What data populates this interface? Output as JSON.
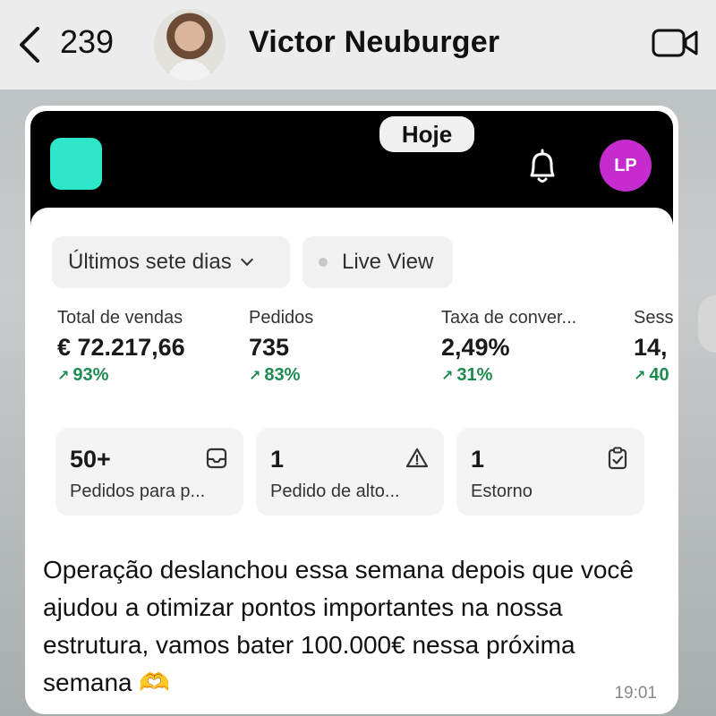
{
  "header": {
    "back_count": "239",
    "contact_name": "Victor Neuburger"
  },
  "message": {
    "screenshot": {
      "date_pill": "Hoje",
      "user_initials": "LP",
      "filters": {
        "range_label": "Últimos sete dias",
        "live_label": "Live View"
      },
      "metrics": [
        {
          "label": "Total de vendas",
          "value": "€ 72.217,66",
          "change": "93%"
        },
        {
          "label": "Pedidos",
          "value": "735",
          "change": "83%"
        },
        {
          "label": "Taxa de conver...",
          "value": "2,49%",
          "change": "31%"
        },
        {
          "label": "Sess",
          "value": "14,",
          "change": "40"
        }
      ],
      "tiles": [
        {
          "number": "50+",
          "label": "Pedidos para p...",
          "icon": "inbox-icon"
        },
        {
          "number": "1",
          "label": "Pedido de alto...",
          "icon": "warning-icon"
        },
        {
          "number": "1",
          "label": "Estorno",
          "icon": "clipboard-check-icon"
        }
      ],
      "colors": {
        "logo": "#2ee6c8",
        "avatar": "#c62bd0",
        "positive": "#1d8a4f"
      }
    },
    "text": "Operação deslanchou essa semana depois que você ajudou a otimizar pontos importantes na nossa estrutura, vamos bater 100.000€ nessa próxima semana 🫶",
    "time": "19:01"
  }
}
